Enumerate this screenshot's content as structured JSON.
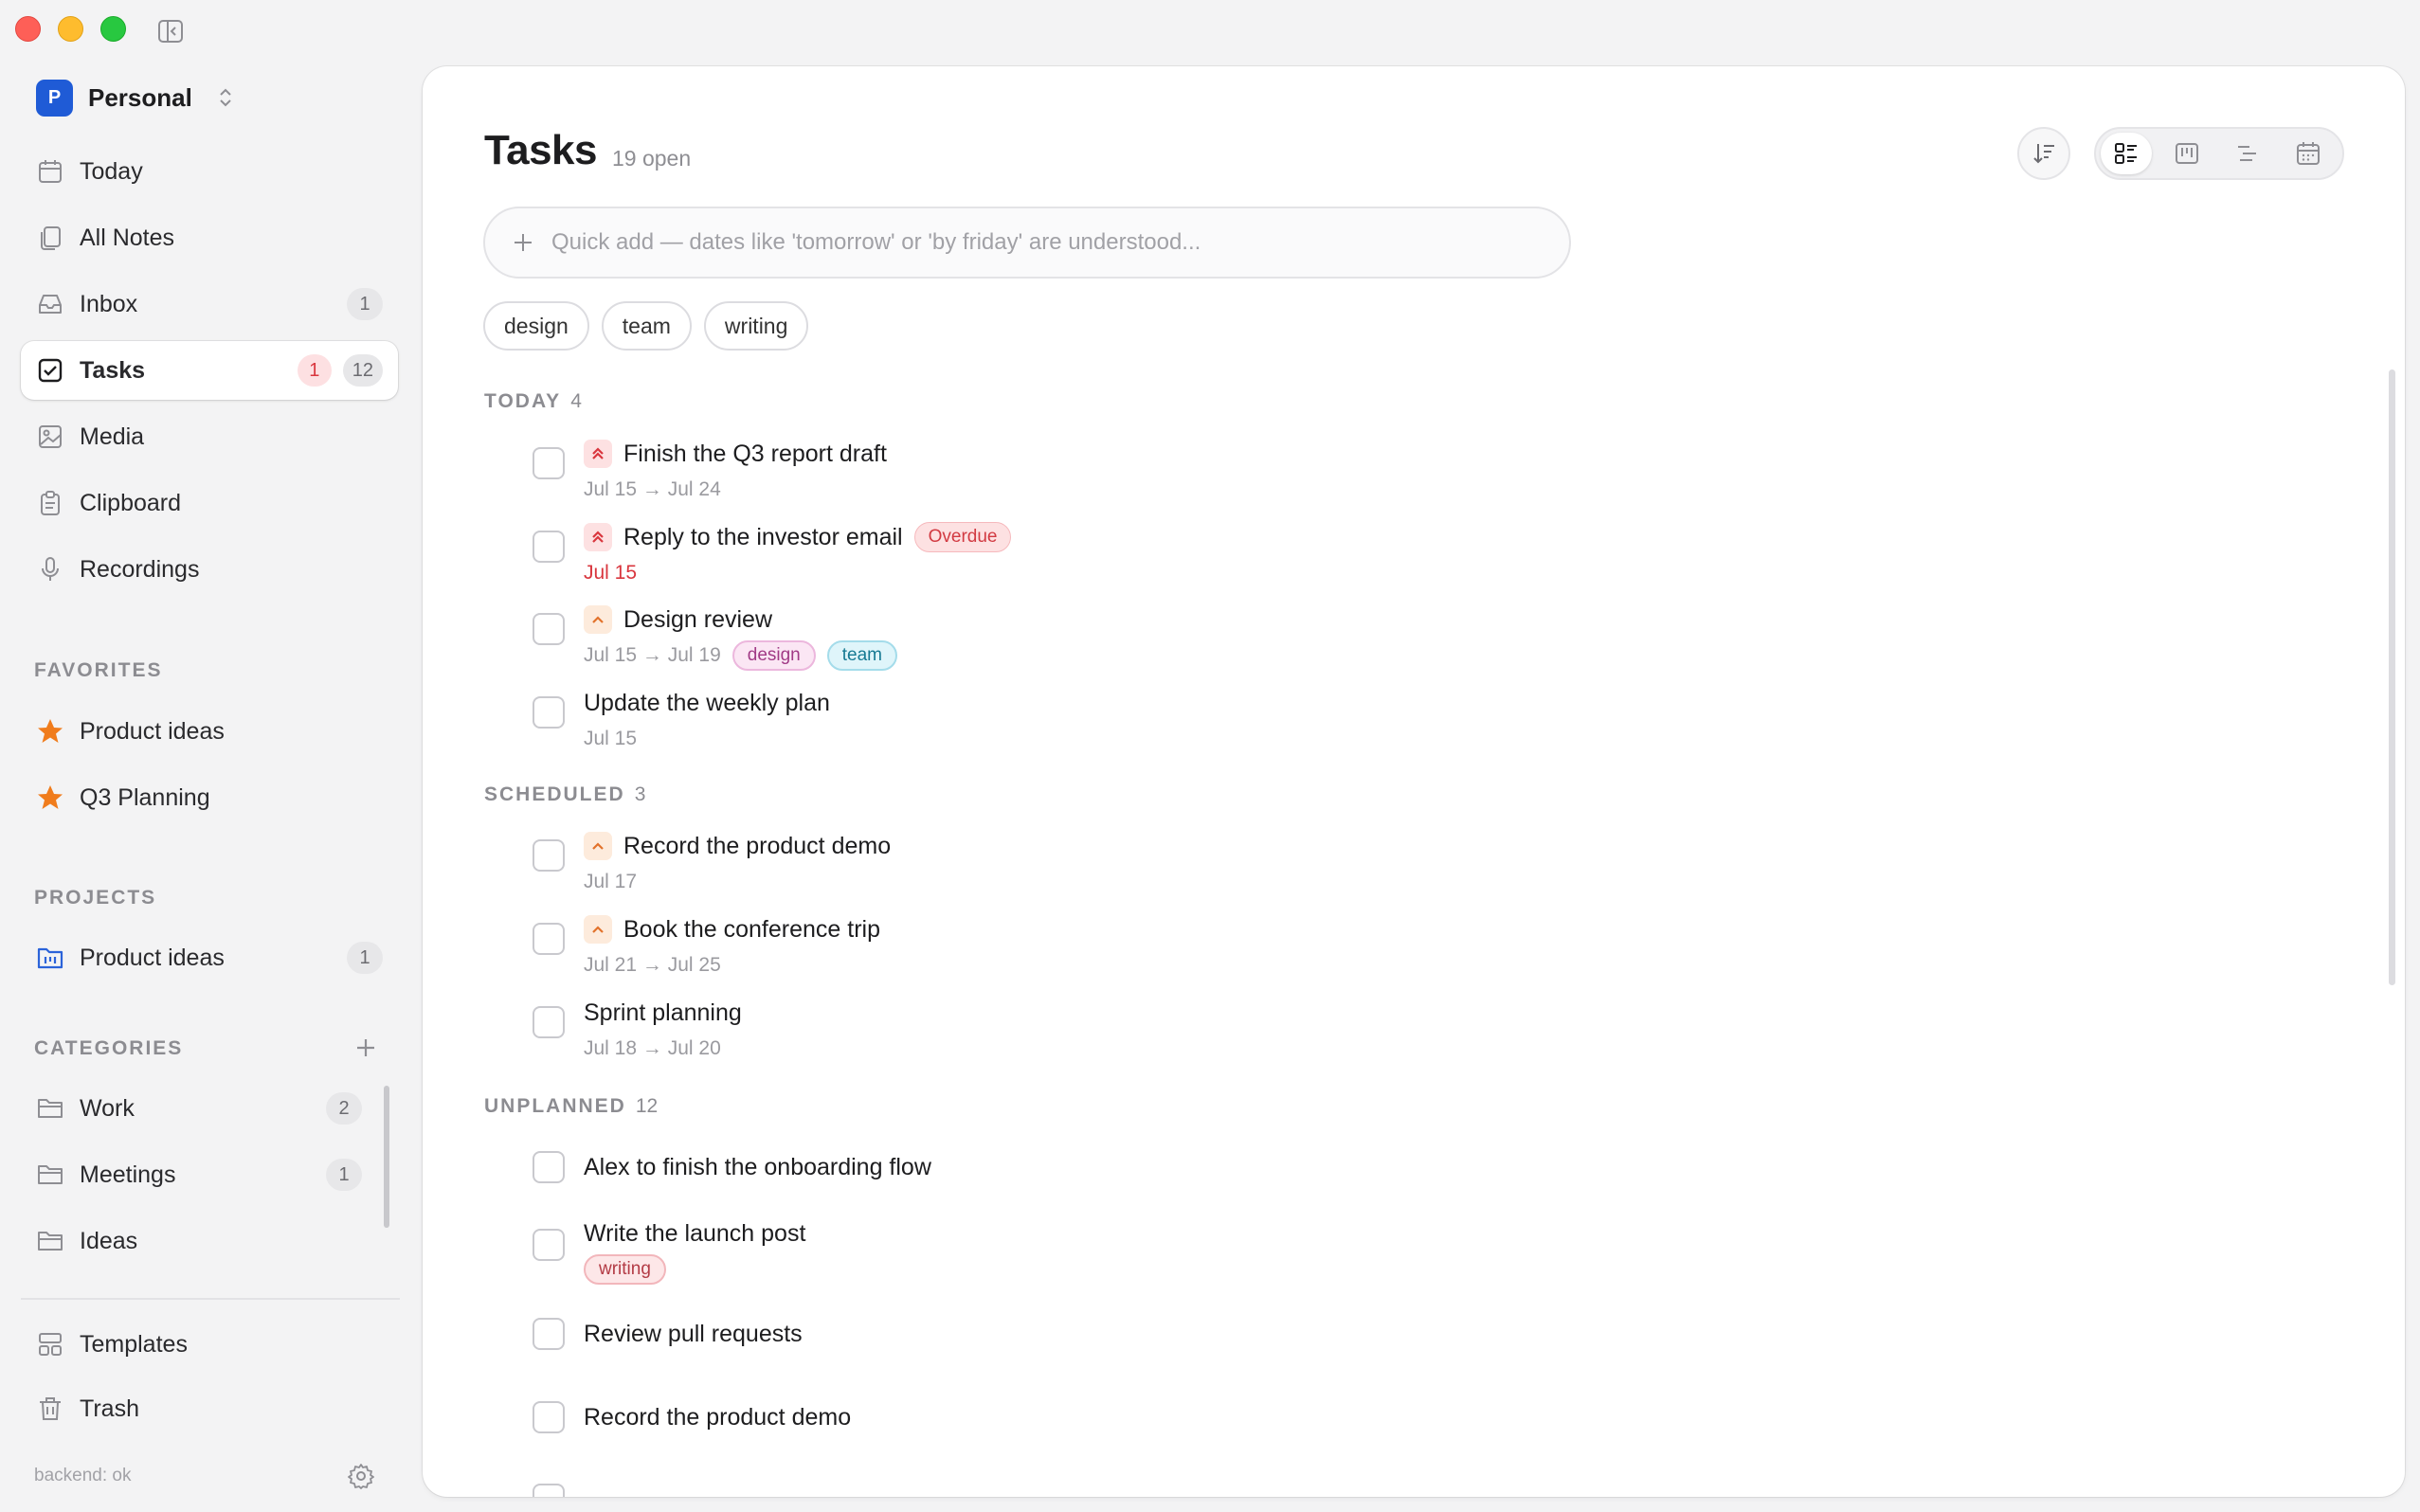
{
  "workspace": {
    "initial": "P",
    "name": "Personal"
  },
  "nav": [
    {
      "label": "Today",
      "icon": "calendar-icon"
    },
    {
      "label": "All Notes",
      "icon": "notes-icon"
    },
    {
      "label": "Inbox",
      "icon": "inbox-icon",
      "badge": "1"
    },
    {
      "label": "Tasks",
      "icon": "checkbox-icon",
      "badge_alert": "1",
      "badge": "12",
      "active": true
    },
    {
      "label": "Media",
      "icon": "image-icon"
    },
    {
      "label": "Clipboard",
      "icon": "clipboard-icon"
    },
    {
      "label": "Recordings",
      "icon": "microphone-icon"
    }
  ],
  "favorites": {
    "label": "FAVORITES",
    "items": [
      {
        "label": "Product ideas",
        "icon": "star-icon"
      },
      {
        "label": "Q3 Planning",
        "icon": "star-icon"
      }
    ]
  },
  "projects": {
    "label": "PROJECTS",
    "items": [
      {
        "label": "Product ideas",
        "icon": "project-folder-icon",
        "badge": "1"
      }
    ]
  },
  "categories": {
    "label": "CATEGORIES",
    "items": [
      {
        "label": "Work",
        "icon": "folder-icon",
        "badge": "2"
      },
      {
        "label": "Meetings",
        "icon": "folder-icon",
        "badge": "1"
      },
      {
        "label": "Ideas",
        "icon": "folder-icon"
      }
    ]
  },
  "bottom_nav": [
    {
      "label": "Templates",
      "icon": "templates-icon"
    },
    {
      "label": "Trash",
      "icon": "trash-icon"
    }
  ],
  "status": {
    "backend": "backend: ok"
  },
  "main": {
    "title": "Tasks",
    "open_count": "19 open",
    "quick_add_placeholder": "Quick add — dates like 'tomorrow' or 'by friday' are understood...",
    "filters": [
      "design",
      "team",
      "writing"
    ],
    "groups": {
      "today": {
        "label": "TODAY",
        "count": "4",
        "tasks": [
          {
            "title": "Finish the Q3 report draft",
            "priority": "high",
            "dates": "Jul 15 → Jul 24"
          },
          {
            "title": "Reply to the investor email",
            "priority": "high",
            "badge": "Overdue",
            "dates": "Jul 15",
            "overdue": true
          },
          {
            "title": "Design review",
            "priority": "medium",
            "dates": "Jul 15 → Jul 19",
            "tags": [
              "design",
              "team"
            ]
          },
          {
            "title": "Update the weekly plan",
            "dates": "Jul 15"
          }
        ]
      },
      "scheduled": {
        "label": "SCHEDULED",
        "count": "3",
        "tasks": [
          {
            "title": "Record the product demo",
            "priority": "medium",
            "dates": "Jul 17"
          },
          {
            "title": "Book the conference trip",
            "priority": "medium",
            "dates": "Jul 21 → Jul 25"
          },
          {
            "title": "Sprint planning",
            "dates": "Jul 18 → Jul 20"
          }
        ]
      },
      "unplanned": {
        "label": "UNPLANNED",
        "count": "12",
        "tasks": [
          {
            "title": "Alex to finish the onboarding flow"
          },
          {
            "title": "Write the launch post",
            "tags": [
              "writing"
            ]
          },
          {
            "title": "Review pull requests"
          },
          {
            "title": "Record the product demo"
          }
        ]
      }
    }
  },
  "colors": {
    "accent": "#1f5bd6",
    "alert": "#d9363e",
    "priority_medium": "#e2722b",
    "favorite_star": "#f07c1c"
  }
}
